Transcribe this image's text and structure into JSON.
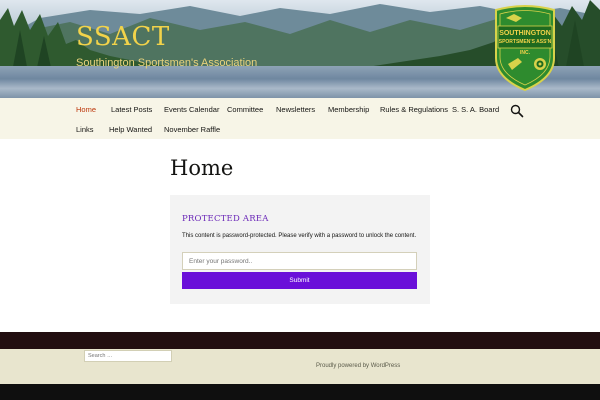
{
  "site": {
    "title": "SSACT",
    "description": "Southington Sportsmen's Association",
    "badge_lines": [
      "SOUTHINGTON",
      "SPORTSMEN'S ASS'N",
      "INC."
    ]
  },
  "nav": {
    "items": [
      {
        "label": "Home",
        "active": true
      },
      {
        "label": "Latest Posts"
      },
      {
        "label": "Events Calendar"
      },
      {
        "label": "Committee"
      },
      {
        "label": "Newsletters"
      },
      {
        "label": "Membership"
      },
      {
        "label": "Rules & Regulations"
      },
      {
        "label": "S. S. A. Board"
      },
      {
        "label": "Links"
      },
      {
        "label": "Help Wanted"
      },
      {
        "label": "November Raffle"
      }
    ],
    "search_icon": "search-icon"
  },
  "main": {
    "page_title": "Home",
    "protected": {
      "heading": "PROTECTED AREA",
      "message": "This content is password-protected. Please verify with a password to unlock the content.",
      "password_placeholder": "Enter your password..",
      "submit_label": "Submit"
    }
  },
  "footer": {
    "search_placeholder": "Search …",
    "powered_by": "Proudly powered by WordPress"
  },
  "colors": {
    "accent": "#6a0fd9",
    "active_nav": "#bc360a",
    "nav_bg": "#f7f5e7",
    "footer_dark": "#220e10",
    "footer_light": "#e8e5ce",
    "title_yellow": "#f2d34a"
  }
}
